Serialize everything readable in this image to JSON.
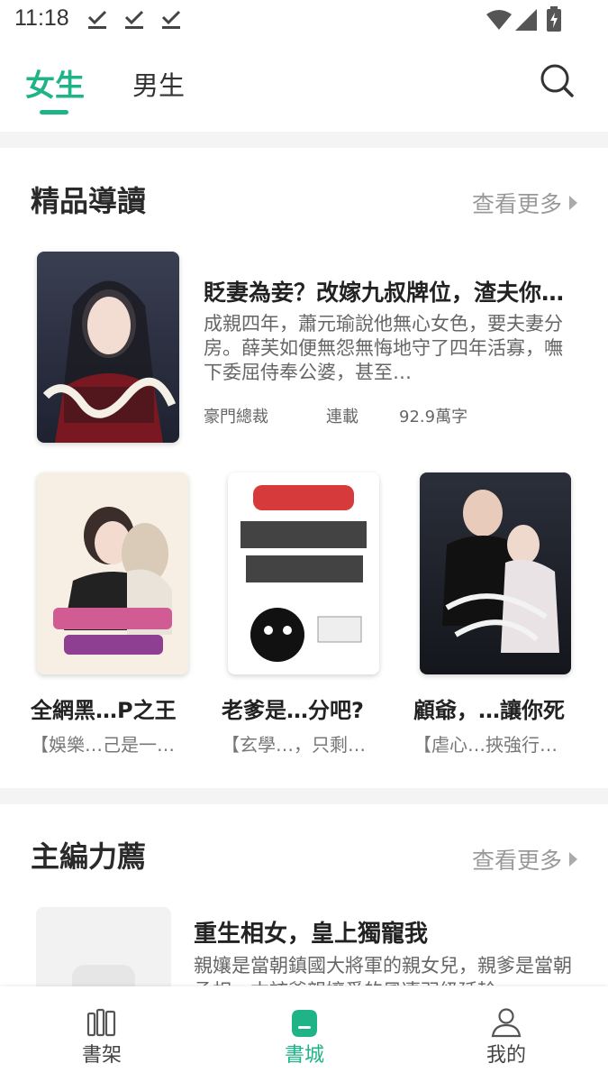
{
  "status_bar": {
    "time": "11:18",
    "icons": [
      "download-done-icon",
      "download-done-icon",
      "download-done-icon",
      "wifi-icon",
      "signal-icon",
      "battery-charging-icon"
    ]
  },
  "top_tabs": {
    "tabs": [
      {
        "label": "女生",
        "active": true
      },
      {
        "label": "男生",
        "active": false
      }
    ],
    "search_icon": "search-icon"
  },
  "colors": {
    "accent": "#1fb487",
    "band": "#f4f4f4"
  },
  "section_featured": {
    "title": "精品導讀",
    "more_label": "查看更多",
    "featured_book": {
      "title": "貶妻為妾？改嫁九叔牌位，渣夫你…",
      "desc": "成親四年，蕭元瑜說他無心女色，要夫妻分房。薛芙如便無怨無悔地守了四年活寡，嘸下委屈侍奉公婆，甚至…",
      "category": "豪門總裁",
      "status": "連載",
      "words": "92.9萬字"
    },
    "books": [
      {
        "title": "全網黑…P之王",
        "desc": "【娛樂…己是一…"
      },
      {
        "title": "老爹是…分吧?",
        "desc": "【玄學…，只剩…"
      },
      {
        "title": "顧爺，…讓你死",
        "desc": "【虐心…挾強行…"
      }
    ]
  },
  "section_editor": {
    "title": "主編力薦",
    "more_label": "查看更多",
    "book": {
      "title": "重生相女，皇上獨寵我",
      "desc": "親孃是當朝鎮國大將軍的親女兒，親爹是當朝丞相，本該爹親孃愛的風凄羽級延輪"
    }
  },
  "bottom_nav": {
    "items": [
      {
        "label": "書架",
        "icon": "bookshelf-icon",
        "active": false
      },
      {
        "label": "書城",
        "icon": "store-icon",
        "active": true
      },
      {
        "label": "我的",
        "icon": "profile-icon",
        "active": false
      }
    ]
  }
}
